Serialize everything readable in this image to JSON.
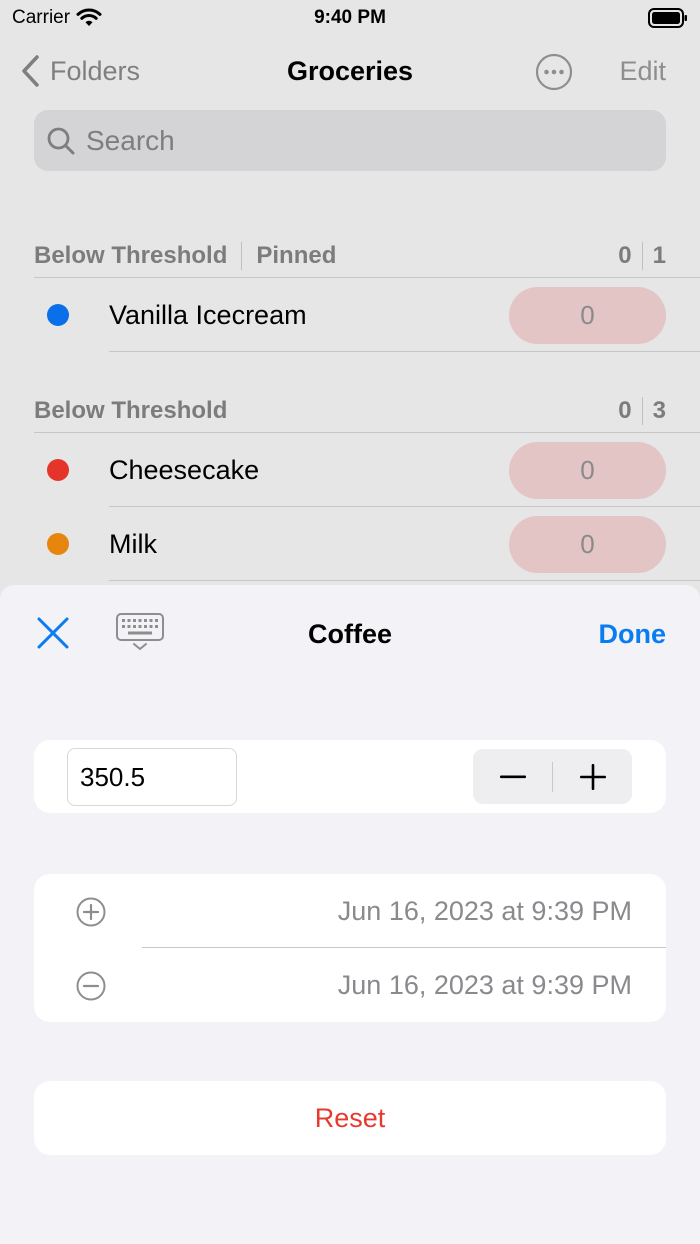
{
  "status_bar": {
    "carrier": "Carrier",
    "time": "9:40 PM"
  },
  "nav": {
    "back_label": "Folders",
    "title": "Groceries",
    "edit_label": "Edit"
  },
  "search": {
    "placeholder": "Search"
  },
  "sections": [
    {
      "titles": [
        "Below Threshold",
        "Pinned"
      ],
      "counts": [
        "0",
        "1"
      ],
      "items": [
        {
          "label": "Vanilla Icecream",
          "value": "0",
          "color": "#0a6fe8"
        }
      ]
    },
    {
      "titles": [
        "Below Threshold"
      ],
      "counts": [
        "0",
        "3"
      ],
      "items": [
        {
          "label": "Cheesecake",
          "value": "0",
          "color": "#e5352b"
        },
        {
          "label": "Milk",
          "value": "0",
          "color": "#e6860c"
        }
      ]
    }
  ],
  "sheet": {
    "title": "Coffee",
    "done_label": "Done",
    "quantity_value": "350.5",
    "dates": [
      {
        "icon": "plus-circle-icon",
        "text": "Jun 16, 2023 at 9:39 PM"
      },
      {
        "icon": "minus-circle-icon",
        "text": "Jun 16, 2023 at 9:39 PM"
      }
    ],
    "reset_label": "Reset"
  },
  "colors": {
    "accent": "#0a7cf2",
    "destructive": "#e8392f",
    "pill_bg": "#e3c5c6"
  }
}
